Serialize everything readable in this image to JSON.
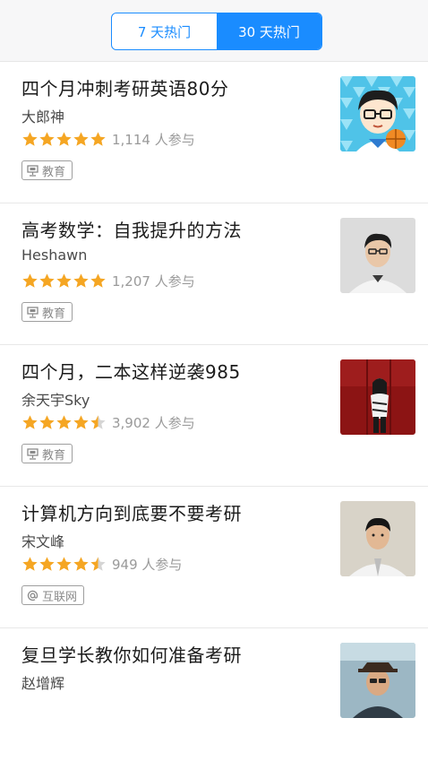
{
  "tabs": [
    {
      "label": "7 天热门",
      "active": false
    },
    {
      "label": "30 天热门",
      "active": true
    }
  ],
  "colors": {
    "accent": "#1a8cff",
    "star": "#f5a623",
    "star_empty": "#d5d5d5"
  },
  "items": [
    {
      "title": "四个月冲刺考研英语80分",
      "author": "大郎神",
      "rating": 5,
      "participants": "1,114 人参与",
      "tag": "教育",
      "tag_icon": "presentation-board-icon",
      "avatar": "cartoon-avatar-with-basketball"
    },
    {
      "title": "高考数学：自我提升的方法",
      "author": "Heshawn",
      "rating": 5,
      "participants": "1,207 人参与",
      "tag": "教育",
      "tag_icon": "presentation-board-icon",
      "avatar": "man-with-glasses-photo"
    },
    {
      "title": "四个月，二本这样逆袭985",
      "author": "余天宇Sky",
      "rating": 4.5,
      "participants": "3,902 人参与",
      "tag": "教育",
      "tag_icon": "presentation-board-icon",
      "avatar": "woman-red-background-photo"
    },
    {
      "title": "计算机方向到底要不要考研",
      "author": "宋文峰",
      "rating": 4.5,
      "participants": "949 人参与",
      "tag": "互联网",
      "tag_icon": "at-sign-icon",
      "avatar": "young-man-portrait-photo"
    },
    {
      "title": "复旦学长教你如何准备考研",
      "author": "赵增辉",
      "rating": 0,
      "participants": "",
      "tag": "",
      "tag_icon": "",
      "avatar": "man-with-hat-photo"
    }
  ]
}
